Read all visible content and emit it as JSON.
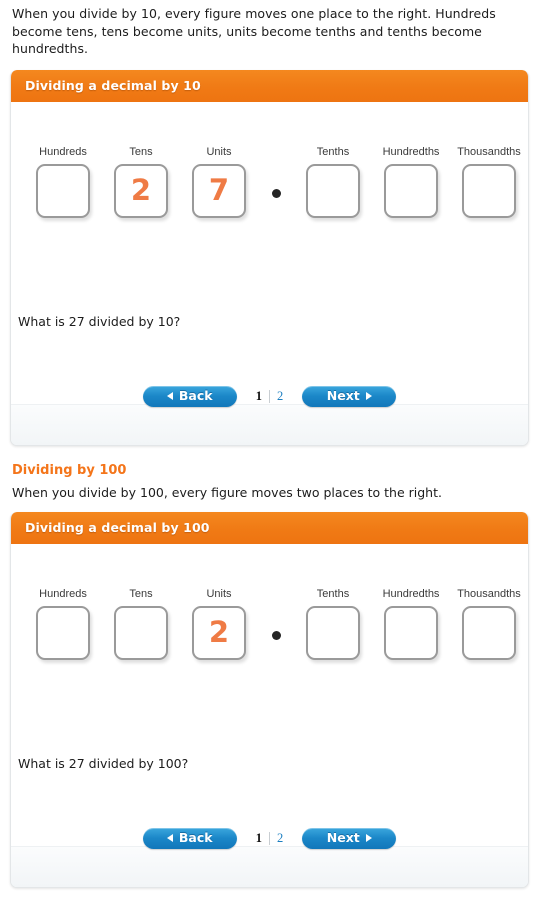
{
  "intro": {
    "paragraph": "When you divide by 10, every figure moves one place to the right. Hundreds become tens, tens become units, units become tenths and tenths become hundredths."
  },
  "section_100": {
    "heading": "Dividing by 100",
    "paragraph": "When you divide by 100, every figure moves two places to the right."
  },
  "colors": {
    "header_orange": "#f07c1f",
    "digit_orange": "#ef7b45",
    "button_blue": "#1b87c8",
    "link_blue": "#1b7ec0",
    "heading_orange": "#f4751a"
  },
  "widgets": [
    {
      "title": "Dividing a decimal by 10",
      "columns": [
        {
          "label": "Hundreds",
          "value": ""
        },
        {
          "label": "Tens",
          "value": "2"
        },
        {
          "label": "Units",
          "value": "7"
        },
        {
          "label": "Tenths",
          "value": ""
        },
        {
          "label": "Hundredths",
          "value": ""
        },
        {
          "label": "Thousandths",
          "value": ""
        }
      ],
      "decimal_point": "•",
      "question": "What is 27 divided by 10?",
      "pager": {
        "back_label": "Back",
        "next_label": "Next",
        "back_icon": "triangle-left-icon",
        "next_icon": "triangle-right-icon",
        "current_page": "1",
        "other_page": "2"
      }
    },
    {
      "title": "Dividing a decimal by 100",
      "columns": [
        {
          "label": "Hundreds",
          "value": ""
        },
        {
          "label": "Tens",
          "value": ""
        },
        {
          "label": "Units",
          "value": "2"
        },
        {
          "label": "Tenths",
          "value": ""
        },
        {
          "label": "Hundredths",
          "value": ""
        },
        {
          "label": "Thousandths",
          "value": ""
        }
      ],
      "decimal_point": "•",
      "question": "What is 27 divided by 100?",
      "pager": {
        "back_label": "Back",
        "next_label": "Next",
        "back_icon": "triangle-left-icon",
        "next_icon": "triangle-right-icon",
        "current_page": "1",
        "other_page": "2"
      }
    }
  ]
}
